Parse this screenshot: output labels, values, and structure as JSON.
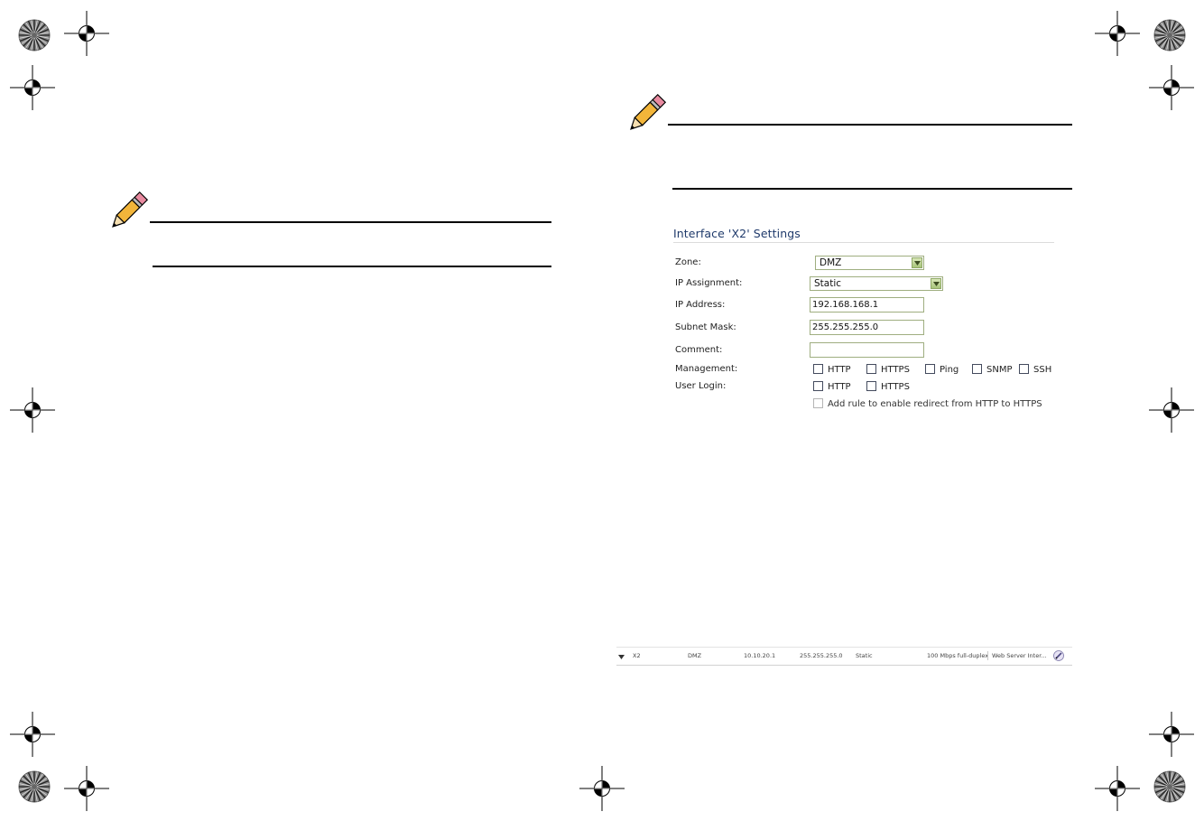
{
  "panel": {
    "title": "Interface 'X2' Settings",
    "fields": {
      "zone": {
        "label": "Zone:",
        "value": "DMZ"
      },
      "ip_assignment": {
        "label": "IP Assignment:",
        "value": "Static"
      },
      "ip_address": {
        "label": "IP Address:",
        "value": "192.168.168.1"
      },
      "subnet_mask": {
        "label": "Subnet Mask:",
        "value": "255.255.255.0"
      },
      "comment": {
        "label": "Comment:",
        "value": ""
      },
      "management": {
        "label": "Management:",
        "options": [
          "HTTP",
          "HTTPS",
          "Ping",
          "SNMP",
          "SSH"
        ]
      },
      "user_login": {
        "label": "User Login:",
        "options": [
          "HTTP",
          "HTTPS"
        ]
      },
      "redirect": {
        "label": "Add rule to enable redirect from HTTP to HTTPS"
      }
    }
  },
  "interface_table": {
    "row": {
      "name": "X2",
      "zone": "DMZ",
      "ip": "10.10.20.1",
      "subnet": "255.255.255.0",
      "assignment": "Static",
      "status": "100 Mbps full-duplex",
      "comment": "Web Server Inter..."
    }
  },
  "icons": {
    "note": "pencil-icon",
    "registration": "crosshair-icon",
    "color_bar": "starburst-icon",
    "expand": "triangle-down-icon",
    "edit": "edit-icon"
  },
  "colors": {
    "title": "#1f3a6b",
    "field_border": "#9fae80",
    "dropdown": "#a8c47a",
    "checkbox_border": "#444b5e"
  }
}
